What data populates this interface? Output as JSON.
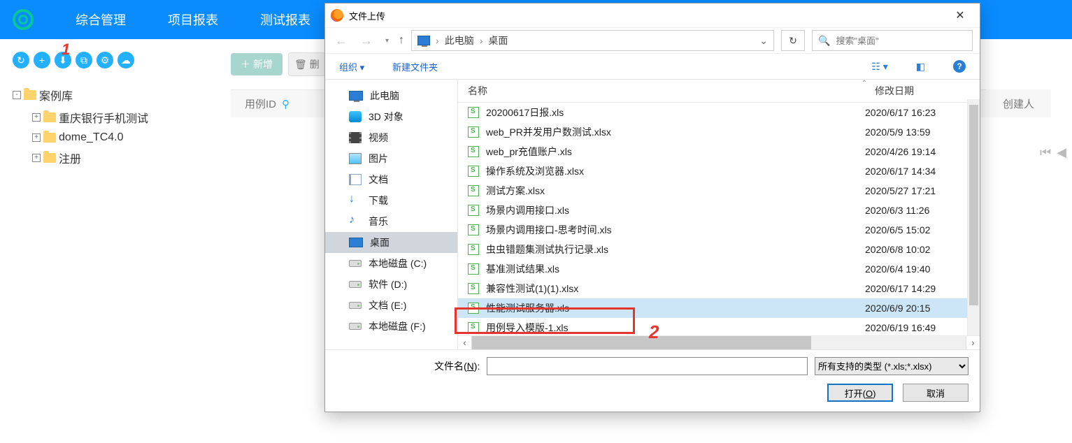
{
  "nav": {
    "items": [
      "综合管理",
      "项目报表",
      "测试报表"
    ]
  },
  "annotations": {
    "m1": "1",
    "m2": "2"
  },
  "toolbar_icons": [
    "↻",
    "+",
    "⬇",
    "⧉",
    "⚙",
    "☁"
  ],
  "tree": {
    "root": "案例库",
    "children": [
      "重庆银行手机测试",
      "dome_TC4.0",
      "注册"
    ]
  },
  "content": {
    "new_btn": "新增",
    "del_btn": "删",
    "col_caseid": "用例ID",
    "col_creator": "创建人"
  },
  "dialog": {
    "title": "文件上传",
    "breadcrumb": [
      "此电脑",
      "桌面"
    ],
    "search_placeholder": "搜索\"桌面\"",
    "organize": "组织",
    "newfolder": "新建文件夹",
    "columns": {
      "name": "名称",
      "date": "修改日期"
    },
    "navtree": [
      {
        "label": "此电脑",
        "icon": "thispc"
      },
      {
        "label": "3D 对象",
        "icon": "3d"
      },
      {
        "label": "视频",
        "icon": "vid"
      },
      {
        "label": "图片",
        "icon": "pic"
      },
      {
        "label": "文档",
        "icon": "doc"
      },
      {
        "label": "下载",
        "icon": "dl"
      },
      {
        "label": "音乐",
        "icon": "music"
      },
      {
        "label": "桌面",
        "icon": "desk",
        "selected": true
      },
      {
        "label": "本地磁盘 (C:)",
        "icon": "drive"
      },
      {
        "label": "软件 (D:)",
        "icon": "drive"
      },
      {
        "label": "文档 (E:)",
        "icon": "drive"
      },
      {
        "label": "本地磁盘 (F:)",
        "icon": "drive"
      }
    ],
    "files": [
      {
        "name": "20200617日报.xls",
        "date": "2020/6/17 16:23",
        "cut": true
      },
      {
        "name": "web_PR并发用户数测试.xlsx",
        "date": "2020/5/9 13:59"
      },
      {
        "name": "web_pr充值账户.xls",
        "date": "2020/4/26 19:14"
      },
      {
        "name": "操作系统及浏览器.xlsx",
        "date": "2020/6/17 14:34"
      },
      {
        "name": "测试方案.xlsx",
        "date": "2020/5/27 17:21"
      },
      {
        "name": "场景内调用接口.xls",
        "date": "2020/6/3 11:26"
      },
      {
        "name": "场景内调用接口-思考时间.xls",
        "date": "2020/6/5 15:02"
      },
      {
        "name": "虫虫错题集测试执行记录.xls",
        "date": "2020/6/8 10:02"
      },
      {
        "name": "基准测试结果.xls",
        "date": "2020/6/4 19:40"
      },
      {
        "name": "兼容性测试(1)(1).xlsx",
        "date": "2020/6/17 14:29"
      },
      {
        "name": "性能测试服务器.xls",
        "date": "2020/6/9 20:15",
        "selected": true
      },
      {
        "name": "用例导入模版-1.xls",
        "date": "2020/6/19 16:49"
      }
    ],
    "filename_label_pre": "文件名(",
    "filename_label_u": "N",
    "filename_label_post": "):",
    "filetype": "所有支持的类型 (*.xls;*.xlsx)",
    "open_pre": "打开(",
    "open_u": "O",
    "open_post": ")",
    "cancel": "取消"
  }
}
